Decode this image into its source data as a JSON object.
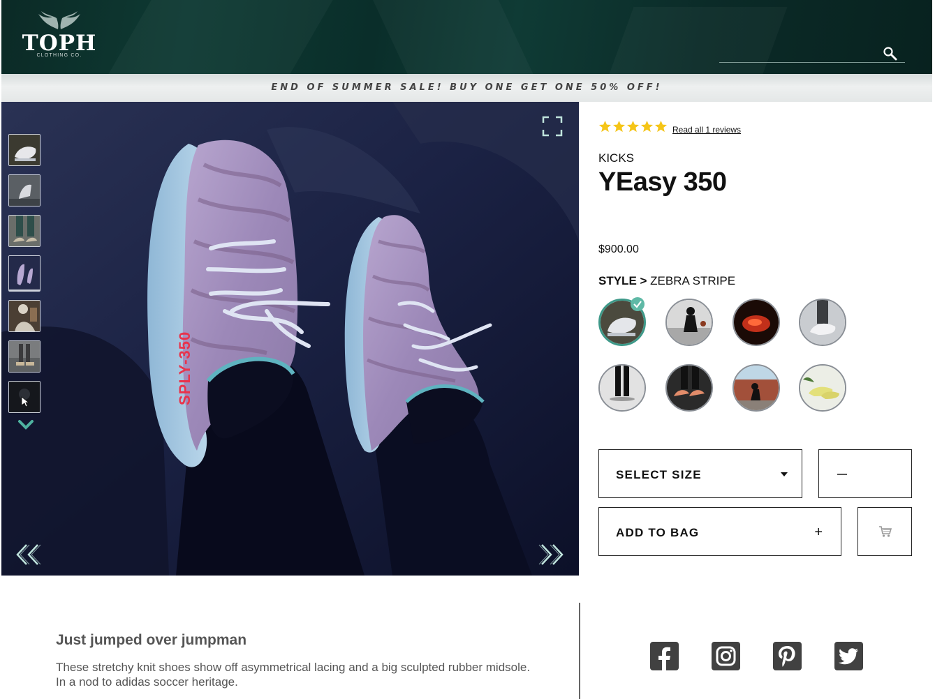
{
  "header": {
    "logo_text": "TOPH",
    "logo_subtext": "CLOTHING CO.",
    "search_placeholder": "",
    "search_icon": "search-icon"
  },
  "promo": {
    "text": "END OF SUMMER SALE! BUY ONE GET ONE 50% OFF!"
  },
  "gallery": {
    "main_image": "yeezy-350-zebra-photo",
    "thumbnails": [
      "thumb-1",
      "thumb-2",
      "thumb-3",
      "thumb-4",
      "thumb-5",
      "thumb-6",
      "thumb-7"
    ],
    "active_thumbnail": 3,
    "icons": {
      "fullscreen": "expand-icon",
      "prev": "double-chevron-left-icon",
      "next": "double-chevron-right-icon",
      "more": "chevron-down-icon"
    },
    "print_text": "SPLY-350"
  },
  "product": {
    "rating": 5,
    "rating_max": 5,
    "reviews_link": "Read all 1 reviews",
    "brand": "KICKS",
    "name": "YEasy 350",
    "price": "$900.00",
    "style_label": "STYLE >",
    "style_value": "ZEBRA STRIPE",
    "styles_selected": 0,
    "style_count": 8
  },
  "actions": {
    "size_label": "SELECT SIZE",
    "add_to_bag_label": "ADD TO BAG",
    "plus": "+",
    "quantity_icon": "minus-icon",
    "cart_icon": "cart-icon"
  },
  "description": {
    "title": "Just jumped over jumpman",
    "body": "These stretchy knit shoes show off asymmetrical lacing and a big sculpted rubber midsole. In a nod to adidas soccer heritage."
  },
  "social": [
    "facebook-icon",
    "instagram-icon",
    "pinterest-icon",
    "twitter-icon"
  ],
  "colors": {
    "header_bg": "#0e3a33",
    "accent": "#4fb3a0",
    "star": "#f5c518",
    "gallery_bg": "#141a38",
    "social_bg": "#414141"
  }
}
